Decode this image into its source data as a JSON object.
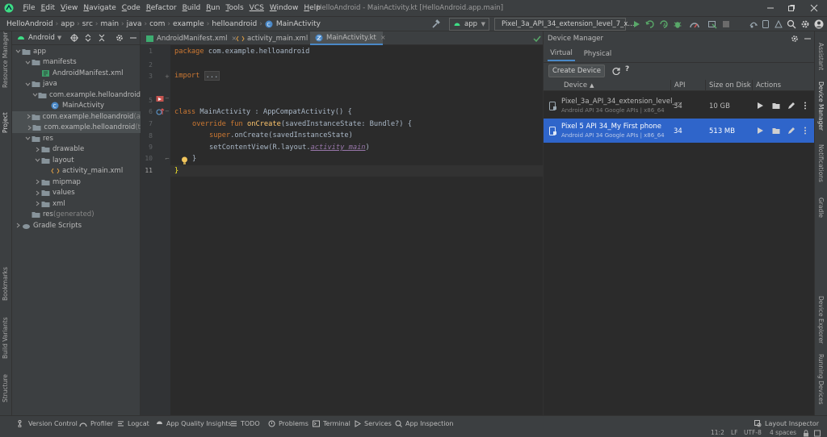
{
  "menu": [
    {
      "u": "F",
      "rest": "ile"
    },
    {
      "u": "E",
      "rest": "dit"
    },
    {
      "u": "V",
      "rest": "iew"
    },
    {
      "u": "N",
      "rest": "avigate"
    },
    {
      "u": "C",
      "rest": "ode"
    },
    {
      "u": "R",
      "rest": "efactor"
    },
    {
      "u": "B",
      "rest": "uild"
    },
    {
      "u": "R",
      "rest": "un"
    },
    {
      "u": "T",
      "rest": "ools"
    },
    {
      "u": "VCS",
      "rest": ""
    },
    {
      "u": "W",
      "rest": "indow"
    },
    {
      "u": "H",
      "rest": "elp"
    }
  ],
  "window_title": "HelloAndroid - MainActivity.kt [HelloAndroid.app.main]",
  "breadcrumbs": [
    "HelloAndroid",
    "app",
    "src",
    "main",
    "java",
    "com",
    "example",
    "helloandroid",
    "MainActivity"
  ],
  "run_config": "app",
  "device_combo": "Pixel_3a_API_34_extension_level_7_x...",
  "left_stripe": {
    "top": [
      "Resource Manager",
      "Project"
    ],
    "bottom": [
      "Bookmarks",
      "Build Variants",
      "Structure"
    ]
  },
  "right_stripe": [
    "Assistant",
    "Device Manager",
    "Notifications",
    "Gradle",
    "Device Explorer",
    "Running Devices"
  ],
  "project": {
    "view": "Android",
    "tree": [
      {
        "label": "app",
        "depth": 0,
        "caret": "v",
        "icon": "folder"
      },
      {
        "label": "manifests",
        "depth": 1,
        "caret": "v",
        "icon": "folder"
      },
      {
        "label": "AndroidManifest.xml",
        "depth": 2,
        "caret": "",
        "icon": "manifest"
      },
      {
        "label": "java",
        "depth": 1,
        "caret": "v",
        "icon": "folder"
      },
      {
        "label": "com.example.helloandroid",
        "depth": 2,
        "caret": "v",
        "icon": "folder"
      },
      {
        "label": "MainActivity",
        "depth": 3,
        "caret": "",
        "icon": "kotlin"
      },
      {
        "label": "com.example.helloandroid",
        "suffix": " (a",
        "depth": 2,
        "caret": ">",
        "icon": "folder",
        "sel": true
      },
      {
        "label": "com.example.helloandroid",
        "suffix": " (t",
        "depth": 2,
        "caret": ">",
        "icon": "folder",
        "sel": true
      },
      {
        "label": "res",
        "depth": 1,
        "caret": "v",
        "icon": "folder"
      },
      {
        "label": "drawable",
        "depth": 2,
        "caret": ">",
        "icon": "folder"
      },
      {
        "label": "layout",
        "depth": 2,
        "caret": "v",
        "icon": "folder"
      },
      {
        "label": "activity_main.xml",
        "depth": 3,
        "caret": "",
        "icon": "xml"
      },
      {
        "label": "mipmap",
        "depth": 2,
        "caret": ">",
        "icon": "folder"
      },
      {
        "label": "values",
        "depth": 2,
        "caret": ">",
        "icon": "folder"
      },
      {
        "label": "xml",
        "depth": 2,
        "caret": ">",
        "icon": "folder"
      },
      {
        "label": "res",
        "suffix": " (generated)",
        "depth": 1,
        "caret": "",
        "icon": "folder"
      },
      {
        "label": "Gradle Scripts",
        "depth": 0,
        "caret": ">",
        "icon": "gradle"
      }
    ]
  },
  "editor": {
    "tabs": [
      "AndroidManifest.xml",
      "activity_main.xml",
      "MainActivity.kt"
    ],
    "active_tab": 2,
    "line_numbers": [
      "1",
      "2",
      "3",
      "5",
      "6",
      "7",
      "8",
      "9",
      "10",
      "11"
    ],
    "code": {
      "l1": [
        "package",
        " com.example.helloandroid"
      ],
      "l3": [
        "import",
        " ",
        "..."
      ],
      "l6": [
        "class",
        " MainActivity : AppCompatActivity() {"
      ],
      "l7": [
        "override fun ",
        "onCreate",
        "(savedInstanceState: Bundle?) {"
      ],
      "l8": [
        "super",
        ".onCreate(savedInstanceState)"
      ],
      "l9": [
        "setContentView(R.layout.",
        "activity_main",
        ")"
      ],
      "l10": "}",
      "l11": "}"
    }
  },
  "device_manager": {
    "title": "Device Manager",
    "tabs": [
      "Virtual",
      "Physical"
    ],
    "create_label": "Create Device",
    "columns": [
      "Device",
      "API",
      "Size on Disk",
      "Actions"
    ],
    "devices": [
      {
        "name": "Pixel_3a_API_34_extension_level_...",
        "sub": "Android API 34 Google APIs | x86_64",
        "api": "34",
        "size": "10 GB",
        "selected": false
      },
      {
        "name": "Pixel 5 API 34_My First phone",
        "sub": "Android API 34 Google APIs | x86_64",
        "api": "34",
        "size": "513 MB",
        "selected": true
      }
    ]
  },
  "bottom_tools": [
    "Version Control",
    "Profiler",
    "Logcat",
    "App Quality Insights",
    "TODO",
    "Problems",
    "Terminal",
    "Services",
    "App Inspection"
  ],
  "layout_inspector": "Layout Inspector",
  "status": [
    "11:2",
    "LF",
    "UTF-8",
    "4 spaces"
  ],
  "colors": {
    "accent": "#4a88c7",
    "selection": "#2f65ca",
    "run": "#59a869",
    "keyword": "#cc7832",
    "function": "#ffc66d"
  }
}
